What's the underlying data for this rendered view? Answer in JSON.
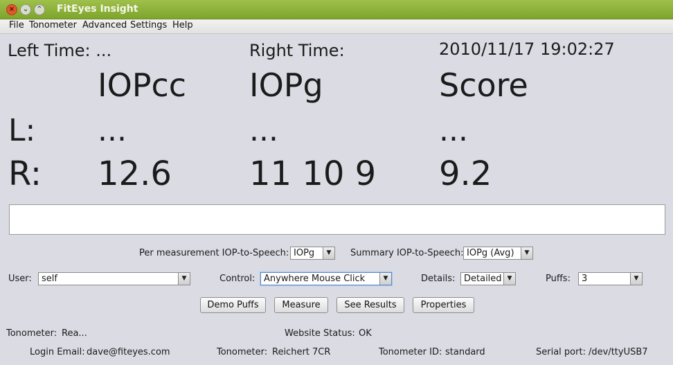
{
  "window": {
    "title": "FitEyes Insight",
    "buttons": {
      "close": "×",
      "minimize": "⌄",
      "maximize": "⌃"
    }
  },
  "menu": [
    "File",
    "Tonometer",
    "Advanced",
    "Settings",
    "Help"
  ],
  "header": {
    "left_time_label": "Left Time: ...",
    "right_time_label": "Right Time:",
    "datetime": "2010/11/17 19:02:27"
  },
  "columns": {
    "iopcc": "IOPcc",
    "iopg": "IOPg",
    "score": "Score"
  },
  "rows": {
    "left": {
      "label": "L:",
      "iopcc": "...",
      "iopg": "...",
      "score": "..."
    },
    "right": {
      "label": "R:",
      "iopcc": "12.6",
      "iopg": "11 10 9",
      "score": "9.2"
    }
  },
  "speech": {
    "per_label": "Per measurement IOP-to-Speech:",
    "per_value": "IOPg",
    "summary_label": "Summary IOP-to-Speech:",
    "summary_value": "IOPg (Avg)"
  },
  "controls": {
    "user_label": "User:",
    "user_value": "self",
    "control_label": "Control:",
    "control_value": "Anywhere Mouse Click",
    "details_label": "Details:",
    "details_value": "Detailed",
    "puffs_label": "Puffs:",
    "puffs_value": "3"
  },
  "buttons": {
    "demo_puffs": "Demo Puffs",
    "measure": "Measure",
    "see_results": "See Results",
    "properties": "Properties"
  },
  "status": {
    "tonometer_label": "Tonometer:",
    "tonometer_value": "Rea...",
    "website_label": "Website Status:",
    "website_value": "OK"
  },
  "footer": {
    "login_label": "Login Email:",
    "login_value": "dave@fiteyes.com",
    "tonometer_label": "Tonometer:",
    "tonometer_value": "Reichert 7CR",
    "tonometer_id_label": "Tonometer ID:",
    "tonometer_id_value": "standard",
    "serial_label": "Serial port:",
    "serial_value": "/dev/ttyUSB7"
  },
  "colors": {
    "titlebar": "#8fb33c",
    "background": "#dadbe3",
    "focus": "#5a87c5"
  }
}
